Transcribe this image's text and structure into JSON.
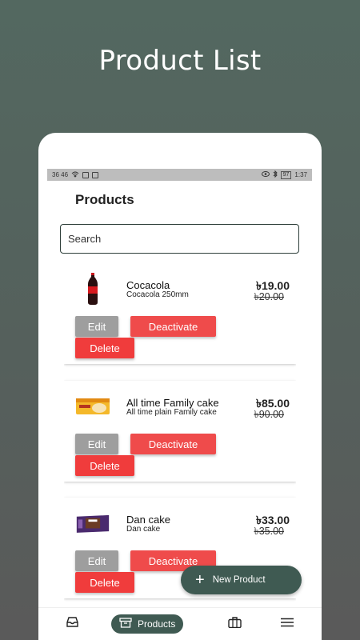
{
  "headline": "Product List",
  "status_bar": {
    "left": "36 46",
    "time": "1:37",
    "battery": "97"
  },
  "page_title": "Products",
  "search": {
    "placeholder": "Search",
    "value": ""
  },
  "products": [
    {
      "name": "Cocacola",
      "description": "Cocacola 250mm",
      "price": "৳19.00",
      "old_price": "৳20.00",
      "icon": "cola-bottle-image"
    },
    {
      "name": "All time Family cake",
      "description": "All time plain Family cake",
      "price": "৳85.00",
      "old_price": "৳90.00",
      "icon": "cake-box-image"
    },
    {
      "name": "Dan cake",
      "description": "Dan cake",
      "price": "৳33.00",
      "old_price": "৳35.00",
      "icon": "cake-pack-image"
    }
  ],
  "buttons": {
    "edit": "Edit",
    "deactivate": "Deactivate",
    "delete": "Delete"
  },
  "fab": {
    "label": "New Product",
    "icon": "plus-icon"
  },
  "nav": {
    "active_label": "Products",
    "items": [
      "inbox-icon",
      "archive-icon",
      "briefcase-icon",
      "menu-icon"
    ]
  },
  "colors": {
    "primary": "#3f5a52",
    "danger": "#ef4b4b",
    "edit": "#9e9e9e"
  }
}
